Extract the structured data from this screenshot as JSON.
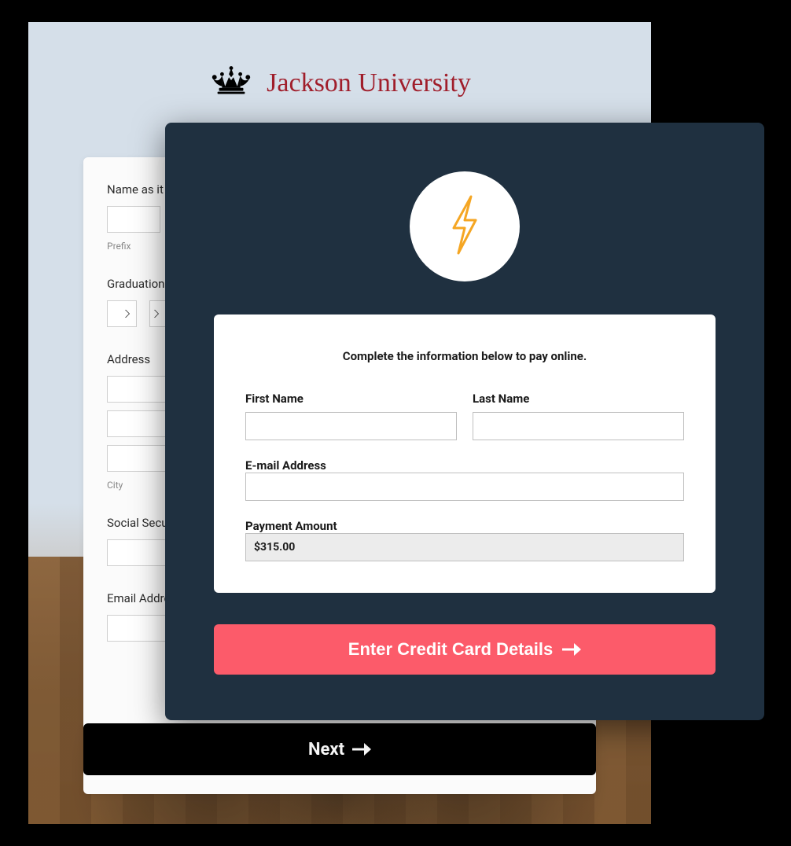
{
  "university": {
    "name": "Jackson University"
  },
  "bg_form": {
    "name_label": "Name as it a",
    "prefix_sublabel": "Prefix",
    "graduation_label": "Graduation",
    "address_label": "Address",
    "city_sublabel": "City",
    "ssn_label": "Social Secur",
    "email_label": "Email Addre"
  },
  "next_button": {
    "label": "Next"
  },
  "payment": {
    "instruction": "Complete the information below to pay online.",
    "first_name_label": "First Name",
    "last_name_label": "Last Name",
    "email_label": "E-mail Address",
    "amount_label": "Payment Amount",
    "amount_value": "$315.00",
    "cta_label": "Enter Credit Card Details"
  }
}
